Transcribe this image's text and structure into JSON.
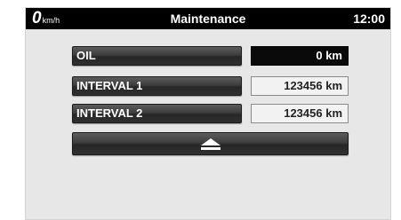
{
  "statusbar": {
    "speed": "0",
    "speed_unit": "km/h",
    "title": "Maintenance",
    "clock": "12:00"
  },
  "rows": [
    {
      "label": "OIL",
      "value": "0 km"
    },
    {
      "label": "INTERVAL 1",
      "value": "123456 km"
    },
    {
      "label": "INTERVAL 2",
      "value": "123456 km"
    }
  ],
  "footer": {
    "scroll_up_icon": "eject-up-icon"
  }
}
